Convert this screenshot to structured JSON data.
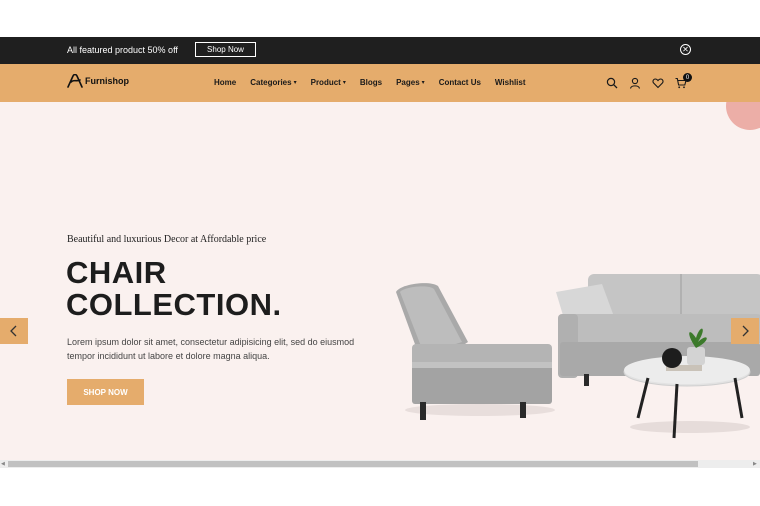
{
  "announcement": {
    "text": "All featured product 50% off",
    "button_label": "Shop Now"
  },
  "brand": {
    "name": "Furnishop"
  },
  "nav": {
    "items": [
      {
        "label": "Home",
        "dropdown": false
      },
      {
        "label": "Categories",
        "dropdown": true
      },
      {
        "label": "Product",
        "dropdown": true
      },
      {
        "label": "Blogs",
        "dropdown": false
      },
      {
        "label": "Pages",
        "dropdown": true
      },
      {
        "label": "Contact Us",
        "dropdown": false
      },
      {
        "label": "Wishlist",
        "dropdown": false
      }
    ],
    "cart_count": "0",
    "icons": [
      "search-icon",
      "user-icon",
      "heart-icon",
      "cart-icon"
    ]
  },
  "hero": {
    "tagline": "Beautiful and luxurious Decor at Affordable price",
    "headline_line1": "CHAIR",
    "headline_line2": "COLLECTION.",
    "description": "Lorem ipsum dolor sit amet, consectetur adipisicing elit, sed do eiusmod tempor incididunt ut labore et dolore magna aliqua.",
    "cta_label": "SHOP NOW"
  },
  "colors": {
    "accent": "#e5ac6c",
    "topbar": "#1f1f1f",
    "hero_bg": "#faf1ef",
    "blob": "#ecaea7"
  }
}
